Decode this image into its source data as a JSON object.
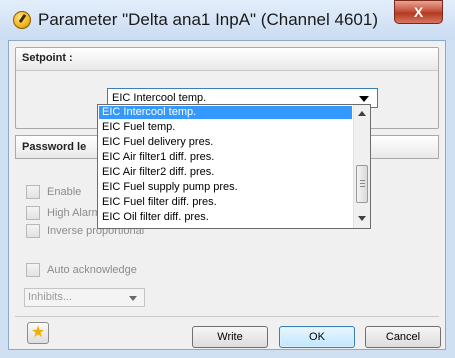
{
  "window": {
    "title": "Parameter \"Delta ana1 InpA\" (Channel 4601)",
    "close_glyph": "X",
    "icon": "gauge-icon"
  },
  "setpoint": {
    "label": "Setpoint :",
    "selected_value": "EIC Intercool temp."
  },
  "dropdown": {
    "options": [
      "EIC Intercool temp.",
      "EIC Fuel temp.",
      "EIC Fuel delivery pres.",
      "EIC Air filter1 diff. pres.",
      "EIC Air filter2 diff. pres.",
      "EIC Fuel supply pump pres.",
      "EIC Fuel filter diff. pres.",
      "EIC Oil filter diff. pres."
    ],
    "highlighted_index": 0
  },
  "password": {
    "label": "Password le"
  },
  "options": {
    "enable": "Enable",
    "high_alarm": "High Alarm",
    "inverse": "Inverse proportional",
    "auto_ack": "Auto acknowledge",
    "inhibits": "Inhibits..."
  },
  "footer": {
    "favorite_icon": "star-icon",
    "write": "Write",
    "ok": "OK",
    "cancel": "Cancel"
  },
  "colors": {
    "selection": "#3399ff",
    "close": "#c7533d",
    "title_bg": "#cfe0f3"
  }
}
